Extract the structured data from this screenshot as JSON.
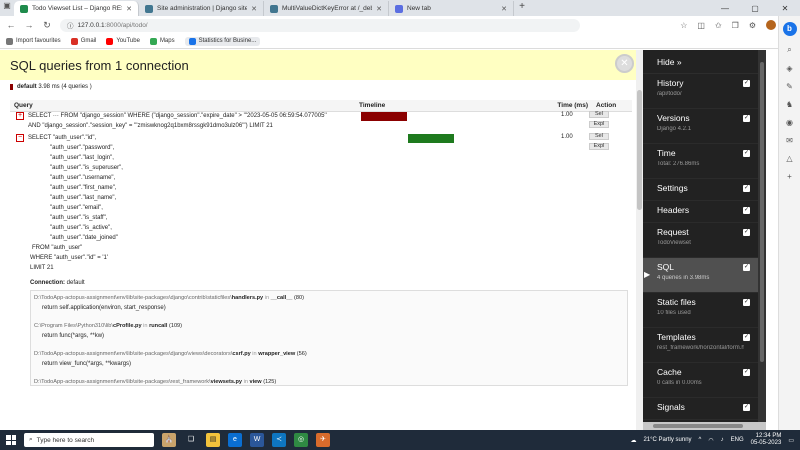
{
  "browser": {
    "tabs": [
      {
        "title": "Todo Viewset List – Django REST",
        "color": "#1f8b4c",
        "active": true
      },
      {
        "title": "Site administration | Django site",
        "color": "#417690",
        "active": false
      },
      {
        "title": "MultiValueDictKeyError at /_debu",
        "color": "#417690",
        "active": false
      },
      {
        "title": "New tab",
        "color": "#5b6ee1",
        "active": false
      }
    ],
    "address": {
      "host": "127.0.0.1",
      "path": ":8000/api/todo/"
    },
    "bookmarks": [
      {
        "label": "Import favourites",
        "color": "#777"
      },
      {
        "label": "Gmail",
        "color": "#d93025"
      },
      {
        "label": "YouTube",
        "color": "#ff0000"
      },
      {
        "label": "Maps",
        "color": "#34a853"
      },
      {
        "label": "Statistics for Busine...",
        "color": "#1a73e8"
      }
    ]
  },
  "sql_panel": {
    "title": "SQL queries from 1 connection",
    "connection_summary": {
      "name": "default",
      "detail": "3.98 ms (4 queries )"
    },
    "columns": {
      "query": "Query",
      "timeline": "Timeline",
      "time": "Time (ms)",
      "action": "Action"
    },
    "queries": [
      {
        "toggle": "+",
        "lines": [
          "SELECT ··· FROM \"django_session\" WHERE (\"django_session\".\"expire_date\" > '''2023-05-05 06:59:54.077005''",
          "AND \"django_session\".\"session_key\" = '''zmiswknog2q1bxm8rssgk91dmo3ulz06''') LIMIT 21"
        ],
        "time": "1.00",
        "bar_color": "#8b0000",
        "bar_start_frac": 0.0,
        "bar_width_frac": 0.5,
        "actions": [
          "Sel",
          "Expl"
        ]
      },
      {
        "toggle": "−",
        "lines": [
          "SELECT \"auth_user\".\"id\",",
          "\"auth_user\".\"password\",",
          "\"auth_user\".\"last_login\",",
          "\"auth_user\".\"is_superuser\",",
          "\"auth_user\".\"username\",",
          "\"auth_user\".\"first_name\",",
          "\"auth_user\".\"last_name\",",
          "\"auth_user\".\"email\",",
          "\"auth_user\".\"is_staff\",",
          "\"auth_user\".\"is_active\",",
          "\"auth_user\".\"date_joined\"",
          "FROM \"auth_user\"",
          "WHERE \"auth_user\".\"id\" = '1'",
          "LIMIT 21"
        ],
        "time": "1.00",
        "bar_color": "#1e7a1e",
        "bar_start_frac": 0.5,
        "bar_width_frac": 0.5,
        "actions": [
          "Sel",
          "Expl"
        ]
      }
    ],
    "connection_label": "Connection:",
    "connection_value": "default",
    "stack": [
      {
        "path": "D:\\TodoApp-actopus-assignment\\env\\lib\\site-packages\\django\\contrib\\staticfiles\\",
        "file": "handlers.py",
        "in": "in",
        "func": "__call__",
        "line": "(80)",
        "code": "return self.application(environ, start_response)"
      },
      {
        "path": "C:\\Program Files\\Python310\\lib\\",
        "file": "cProfile.py",
        "in": "in",
        "func": "runcall",
        "line": "(109)",
        "code": "return func(*args, **kw)"
      },
      {
        "path": "D:\\TodoApp-actopus-assignment\\env\\lib\\site-packages\\django\\views\\decorators\\",
        "file": "csrf.py",
        "in": "in",
        "func": "wrapper_view",
        "line": "(56)",
        "code": "return view_func(*args, **kwargs)"
      },
      {
        "path": "D:\\TodoApp-actopus-assignment\\env\\lib\\site-packages\\rest_framework\\",
        "file": "viewsets.py",
        "in": "in",
        "func": "view",
        "line": "(125)",
        "code": "return self.dispatch(request, *args, **kwargs)"
      },
      {
        "path": "D:\\TodoApp-actopus-assignment\\env\\lib\\site-packages\\rest_framework\\",
        "file": "views.py",
        "in": "in",
        "func": "dispatch",
        "line": "(497)",
        "code": ""
      }
    ]
  },
  "debug_toolbar": {
    "hide_label": "Hide »",
    "panels": [
      {
        "name": "History",
        "sub": "/api/todo/",
        "active": false
      },
      {
        "name": "Versions",
        "sub": "Django 4.2.1",
        "active": false
      },
      {
        "name": "Time",
        "sub": "Total: 276.86ms",
        "active": false
      },
      {
        "name": "Settings",
        "sub": "",
        "active": false
      },
      {
        "name": "Headers",
        "sub": "",
        "active": false
      },
      {
        "name": "Request",
        "sub": "TodoViewset",
        "active": false
      },
      {
        "name": "SQL",
        "sub": "4 queries in 3.98ms",
        "active": true
      },
      {
        "name": "Static files",
        "sub": "10 files used",
        "active": false
      },
      {
        "name": "Templates",
        "sub": "rest_framework/horizontal/form.html",
        "active": false
      },
      {
        "name": "Cache",
        "sub": "0 calls in 0.00ms",
        "active": false
      },
      {
        "name": "Signals",
        "sub": "",
        "active": false
      }
    ]
  },
  "taskbar": {
    "search_placeholder": "Type here to search",
    "weather": "21°C  Partly sunny",
    "lang": "ENG",
    "time": "12:34 PM",
    "date": "05-05-2023"
  }
}
